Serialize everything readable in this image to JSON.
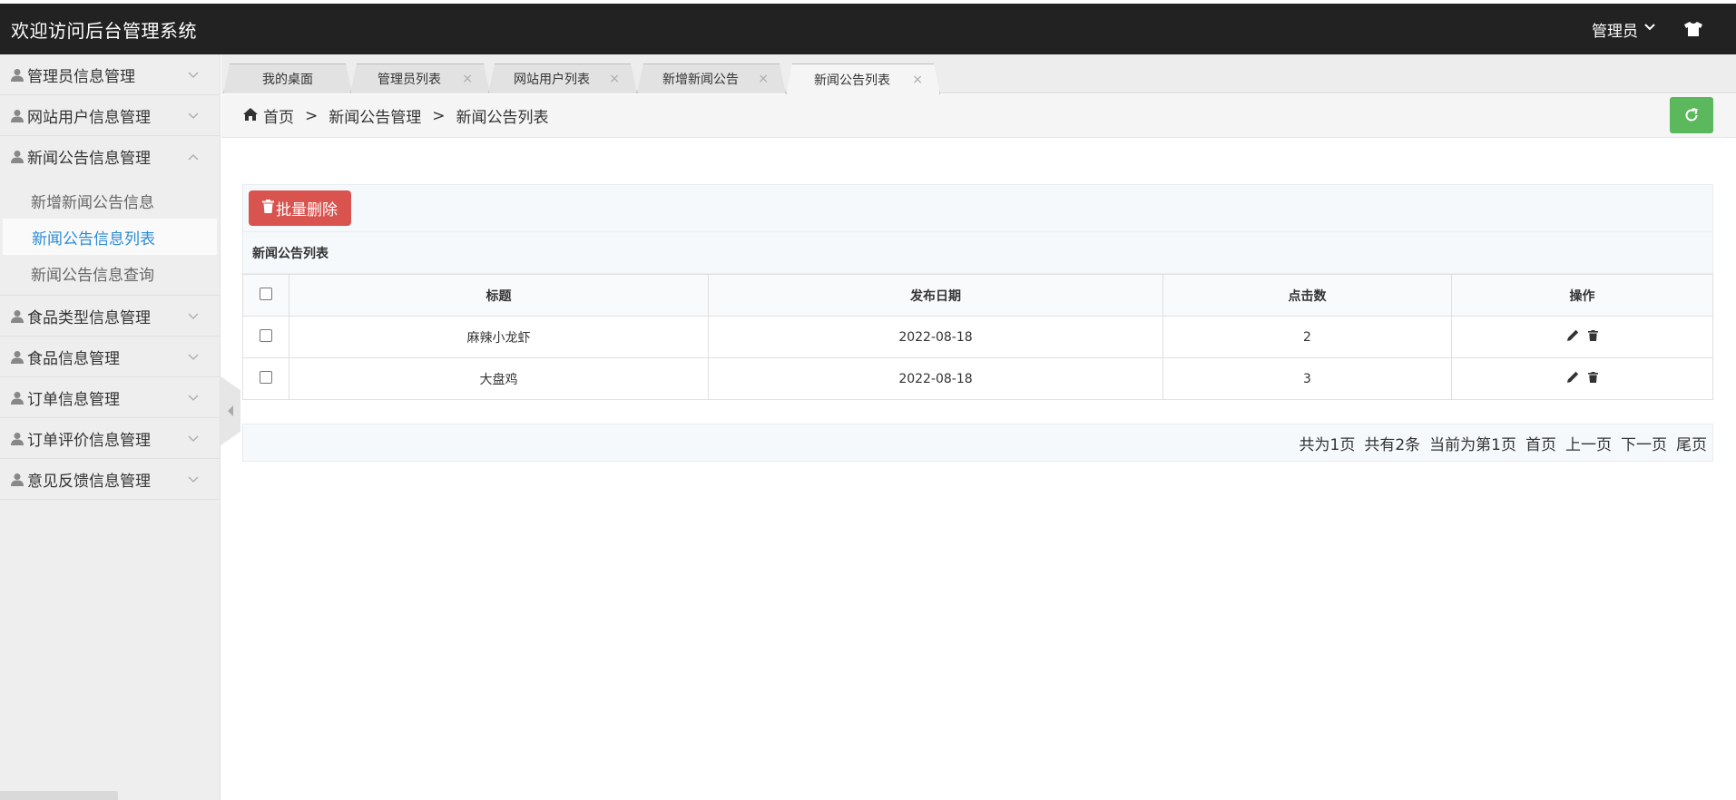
{
  "header": {
    "title": "欢迎访问后台管理系统",
    "user_label": "管理员"
  },
  "sidebar": {
    "items": [
      {
        "label": "管理员信息管理",
        "expanded": false
      },
      {
        "label": "网站用户信息管理",
        "expanded": false
      },
      {
        "label": "新闻公告信息管理",
        "expanded": true,
        "children": [
          "新增新闻公告信息",
          "新闻公告信息列表",
          "新闻公告信息查询"
        ],
        "active_child": "新闻公告信息列表"
      },
      {
        "label": "食品类型信息管理",
        "expanded": false
      },
      {
        "label": "食品信息管理",
        "expanded": false
      },
      {
        "label": "订单信息管理",
        "expanded": false
      },
      {
        "label": "订单评价信息管理",
        "expanded": false
      },
      {
        "label": "意见反馈信息管理",
        "expanded": false
      }
    ]
  },
  "tabs": [
    {
      "label": "我的桌面",
      "closable": false
    },
    {
      "label": "管理员列表",
      "closable": true
    },
    {
      "label": "网站用户列表",
      "closable": true
    },
    {
      "label": "新增新闻公告",
      "closable": true
    },
    {
      "label": "新闻公告列表",
      "closable": true,
      "active": true
    }
  ],
  "tab_close_glyph": "×",
  "breadcrumb": {
    "home": "首页",
    "sep": ">",
    "level1": "新闻公告管理",
    "level2": "新闻公告列表"
  },
  "toolbar": {
    "batch_delete_label": "批量删除"
  },
  "table": {
    "title": "新闻公告列表",
    "columns": [
      "标题",
      "发布日期",
      "点击数",
      "操作"
    ],
    "rows": [
      {
        "title": "麻辣小龙虾",
        "date": "2022-08-18",
        "clicks": "2"
      },
      {
        "title": "大盘鸡",
        "date": "2022-08-18",
        "clicks": "3"
      }
    ]
  },
  "pager": {
    "total_pages": "共为1页",
    "total_records": "共有2条",
    "current": "当前为第1页",
    "first": "首页",
    "prev": "上一页",
    "next": "下一页",
    "last": "尾页"
  },
  "colors": {
    "topbar": "#222222",
    "danger": "#d9534f",
    "success": "#5cb85c",
    "active_link": "#2a8bd6"
  },
  "icons": {
    "user": "user-icon",
    "chevron": "chevron-down-icon",
    "home": "home-icon",
    "refresh": "refresh-icon",
    "trash": "trash-icon",
    "edit": "pencil-icon",
    "theme": "shirt-icon"
  }
}
